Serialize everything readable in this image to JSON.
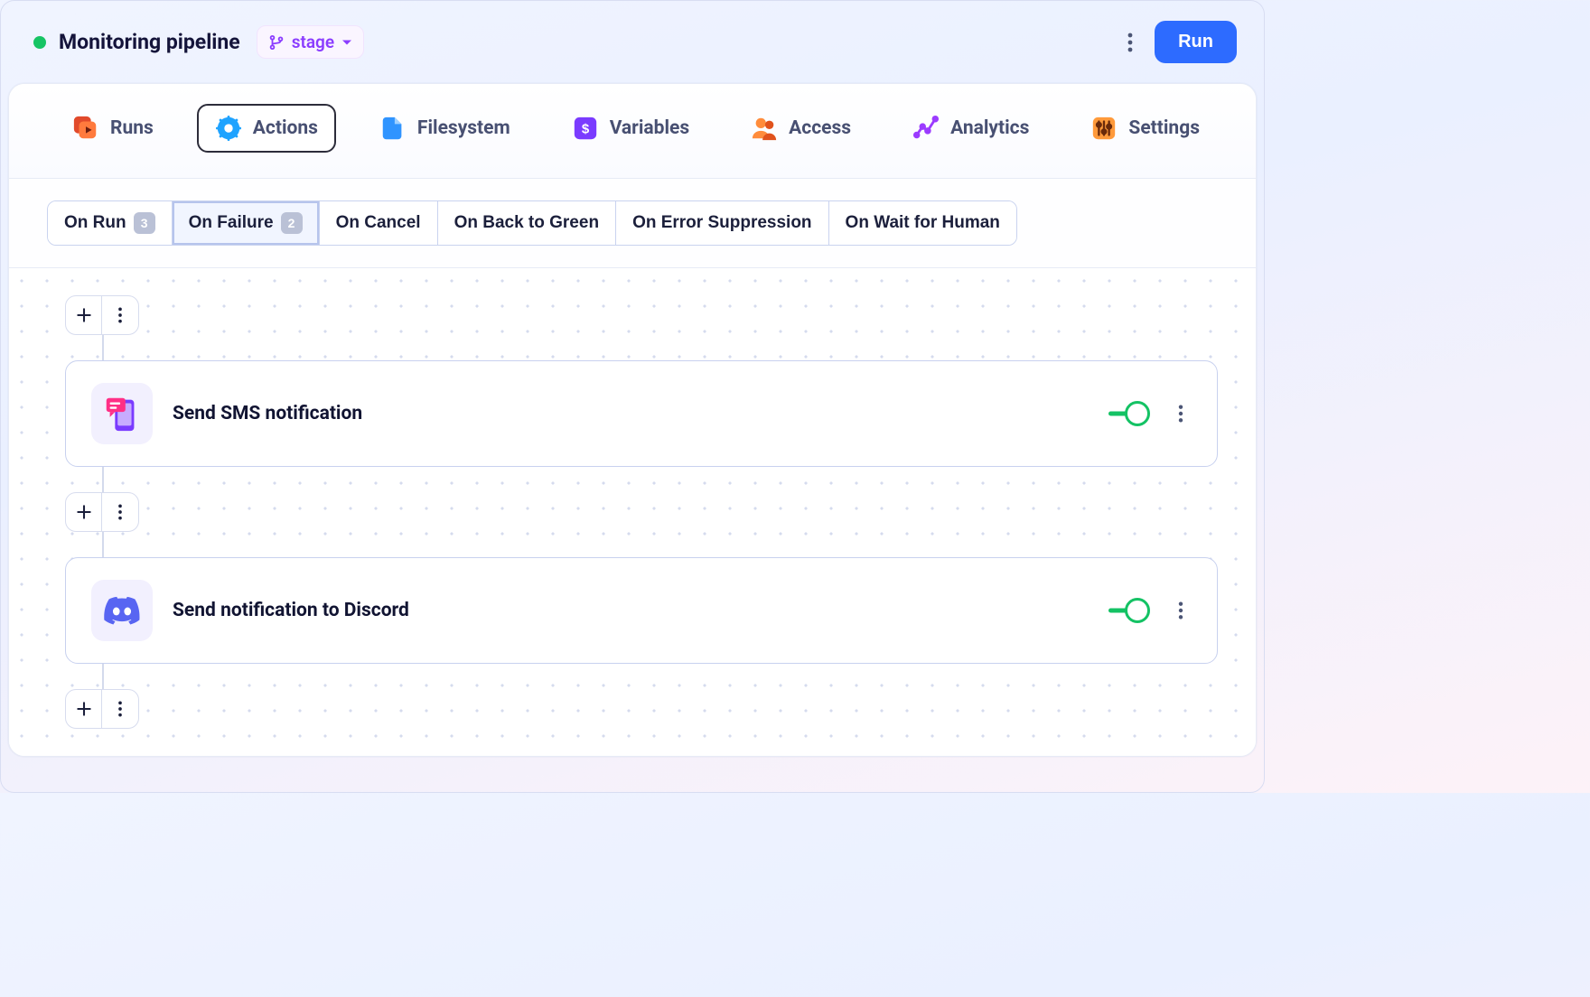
{
  "header": {
    "title": "Monitoring pipeline",
    "stage_label": "stage",
    "run_button": "Run"
  },
  "tabs": [
    {
      "label": "Runs",
      "icon": "runs-icon",
      "color1": "#ff7a3d",
      "color2": "#e14a2b",
      "active": false
    },
    {
      "label": "Actions",
      "icon": "actions-icon",
      "color1": "#1fa3ff",
      "color2": "#1275e6",
      "active": true
    },
    {
      "label": "Filesystem",
      "icon": "filesystem-icon",
      "color1": "#2f94ff",
      "color2": "#1668d6",
      "active": false
    },
    {
      "label": "Variables",
      "icon": "variables-icon",
      "color1": "#7a3bff",
      "color2": "#5120d6",
      "active": false
    },
    {
      "label": "Access",
      "icon": "access-icon",
      "color1": "#ff8c3b",
      "color2": "#e0521c",
      "active": false
    },
    {
      "label": "Analytics",
      "icon": "analytics-icon",
      "color1": "#9b3bff",
      "color2": "#6a20d6",
      "active": false
    },
    {
      "label": "Settings",
      "icon": "settings-icon",
      "color1": "#ff9a3b",
      "color2": "#e0661c",
      "active": false
    }
  ],
  "filters": [
    {
      "label": "On Run",
      "count": 3,
      "active": false
    },
    {
      "label": "On Failure",
      "count": 2,
      "active": true
    },
    {
      "label": "On Cancel",
      "count": null,
      "active": false
    },
    {
      "label": "On Back to Green",
      "count": null,
      "active": false
    },
    {
      "label": "On Error Suppression",
      "count": null,
      "active": false
    },
    {
      "label": "On Wait for Human",
      "count": null,
      "active": false
    }
  ],
  "actions": [
    {
      "title": "Send SMS notification",
      "icon": "sms-icon",
      "enabled": true
    },
    {
      "title": "Send notification to Discord",
      "icon": "discord-icon",
      "enabled": true
    }
  ]
}
